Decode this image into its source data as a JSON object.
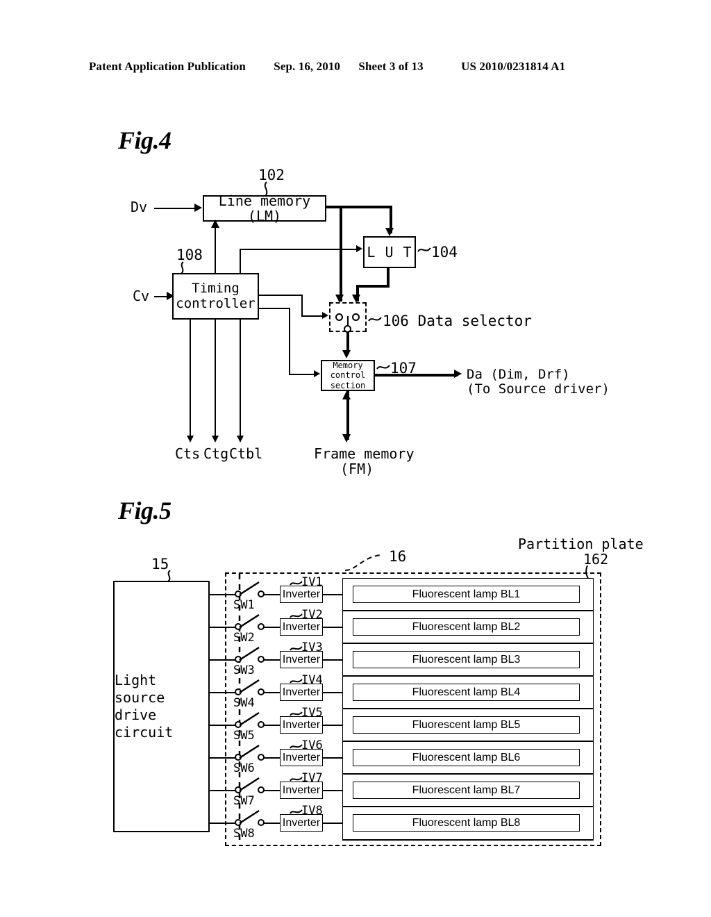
{
  "header": {
    "publication": "Patent Application Publication",
    "date": "Sep. 16, 2010",
    "sheet": "Sheet 3 of 13",
    "patent_number": "US 2010/0231814 A1"
  },
  "fig4": {
    "label": "Fig.4",
    "inputs": {
      "dv": "Dv",
      "cv": "Cv"
    },
    "blocks": [
      {
        "ref": "102",
        "label": "Line  memory  (LM)"
      },
      {
        "ref": "104",
        "label": "L U T"
      },
      {
        "ref": "108",
        "label_line1": "Timing",
        "label_line2": "controller"
      },
      {
        "ref": "106",
        "label": "106 Data selector"
      },
      {
        "ref": "107",
        "label_line1": "Memory",
        "label_line2": "control",
        "label_line3": "section"
      }
    ],
    "ref_102": "102",
    "ref_104": "104",
    "ref_106": "106 Data selector",
    "ref_107": "107",
    "ref_108": "108",
    "outputs": {
      "cts": "Cts",
      "ctg": "Ctg",
      "ctbl": "Ctbl",
      "da_line1": "Da (Dim, Drf)",
      "da_line2": "(To Source driver)",
      "fm_line1": "Frame  memory",
      "fm_line2": "(FM)"
    }
  },
  "fig5": {
    "label": "Fig.5",
    "ref_15": "15",
    "ref_16": "16",
    "partition_line1": "Partition  plate",
    "partition_ref": "162",
    "light_source_line1": "Light  source",
    "light_source_line2": "drive  circuit",
    "inverter_label": "Inverter",
    "channels": [
      {
        "switch": "SW1",
        "inverter_ref": "IV1",
        "lamp": "Fluorescent  lamp  BL1"
      },
      {
        "switch": "SW2",
        "inverter_ref": "IV2",
        "lamp": "Fluorescent  lamp  BL2"
      },
      {
        "switch": "SW3",
        "inverter_ref": "IV3",
        "lamp": "Fluorescent  lamp  BL3"
      },
      {
        "switch": "SW4",
        "inverter_ref": "IV4",
        "lamp": "Fluorescent  lamp  BL4"
      },
      {
        "switch": "SW5",
        "inverter_ref": "IV5",
        "lamp": "Fluorescent  lamp  BL5"
      },
      {
        "switch": "SW6",
        "inverter_ref": "IV6",
        "lamp": "Fluorescent  lamp  BL6"
      },
      {
        "switch": "SW7",
        "inverter_ref": "IV7",
        "lamp": "Fluorescent  lamp  BL7"
      },
      {
        "switch": "SW8",
        "inverter_ref": "IV8",
        "lamp": "Fluorescent  lamp  BL8"
      }
    ]
  },
  "colors": {
    "ink": "#000000",
    "paper": "#ffffff"
  }
}
